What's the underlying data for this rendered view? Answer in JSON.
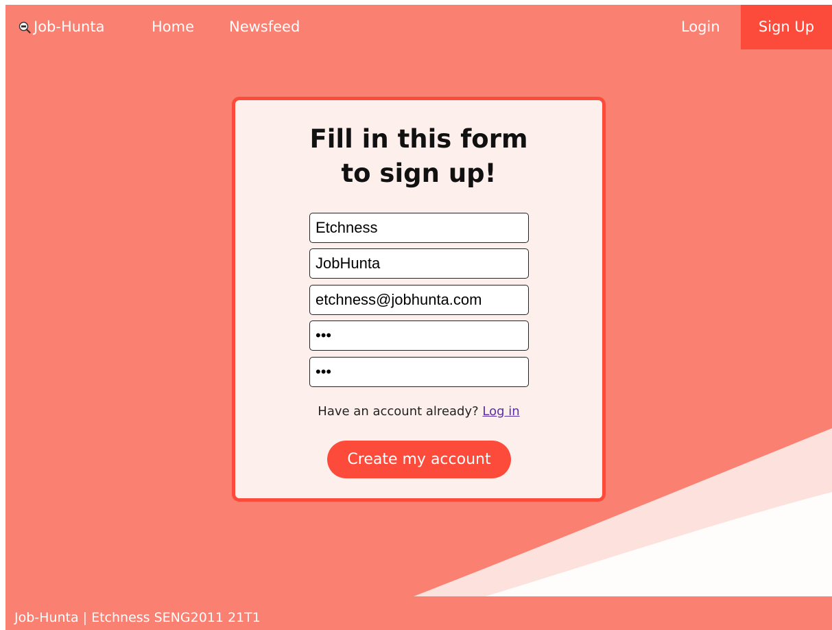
{
  "navbar": {
    "brand_label": "Job-Hunta",
    "brand_icon": "magnifier-job-icon",
    "home_label": "Home",
    "newsfeed_label": "Newsfeed",
    "login_label": "Login",
    "signup_label": "Sign Up"
  },
  "form": {
    "title_line1": "Fill in this form",
    "title_line2": "to sign up!",
    "first_name_value": "Etchness",
    "last_name_value": "JobHunta",
    "email_value": "etchness@jobhunta.com",
    "password_value": "abc",
    "confirm_password_value": "abc",
    "have_account_text": "Have an account already?",
    "login_link_label": "Log in",
    "submit_label": "Create my account"
  },
  "footer": {
    "text": "Job-Hunta | Etchness SENG2011 21T1"
  },
  "colors": {
    "background": "#fa8072",
    "accent": "#fd4b3b",
    "card_background": "#fdefec",
    "link": "#5a2ea6"
  }
}
